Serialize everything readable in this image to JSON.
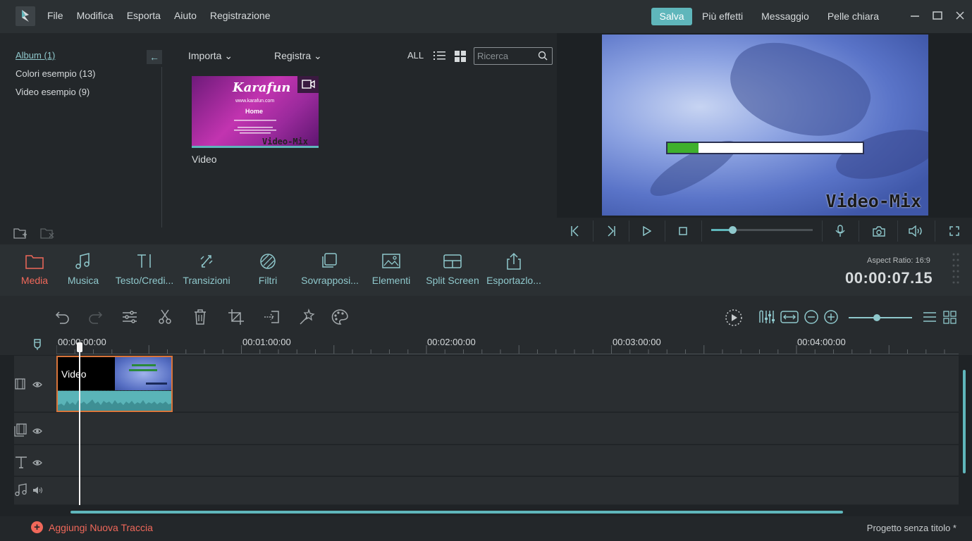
{
  "app": {
    "menu": [
      "File",
      "Modifica",
      "Esporta",
      "Aiuto",
      "Registrazione"
    ],
    "save_label": "Salva",
    "top_links": [
      "Più effetti",
      "Messaggio",
      "Pelle chiara"
    ],
    "accent_color": "#5fb6bb",
    "active_color": "#f0685a"
  },
  "album": {
    "items": [
      "Album (1)",
      "Colori esempio (13)",
      "Video esempio (9)"
    ]
  },
  "library": {
    "import_label": "Importa",
    "record_label": "Registra",
    "filter_label": "ALL",
    "search_placeholder": "Ricerca",
    "thumb": {
      "title": "Karafun",
      "url": "www.karafun.com",
      "heading": "Home",
      "watermark": "Video-Mix",
      "label": "Video"
    }
  },
  "preview": {
    "watermark": "Video-Mix",
    "progress": 0.16,
    "volume": 0.22
  },
  "modules": [
    {
      "label": "Media",
      "icon": "folder-icon"
    },
    {
      "label": "Musica",
      "icon": "music-note-icon"
    },
    {
      "label": "Testo/Credi...",
      "icon": "text-icon"
    },
    {
      "label": "Transizioni",
      "icon": "transition-icon"
    },
    {
      "label": "Filtri",
      "icon": "filter-icon"
    },
    {
      "label": "Sovrapposi...",
      "icon": "overlay-icon"
    },
    {
      "label": "Elementi",
      "icon": "image-icon"
    },
    {
      "label": "Split Screen",
      "icon": "split-screen-icon"
    },
    {
      "label": "Esportazlo...",
      "icon": "export-icon"
    }
  ],
  "status": {
    "aspect_ratio": "Aspect Ratio: 16:9",
    "timecode": "00:00:07.15"
  },
  "timeline": {
    "ruler": [
      "00:00:00:00",
      "00:01:00:00",
      "00:02:00:00",
      "00:03:00:00",
      "00:04:00:00"
    ],
    "clip_label": "Video",
    "zoom": 0.5
  },
  "footer": {
    "add_track": "Aggiungi Nuova Traccia",
    "project": "Progetto senza titolo *"
  }
}
